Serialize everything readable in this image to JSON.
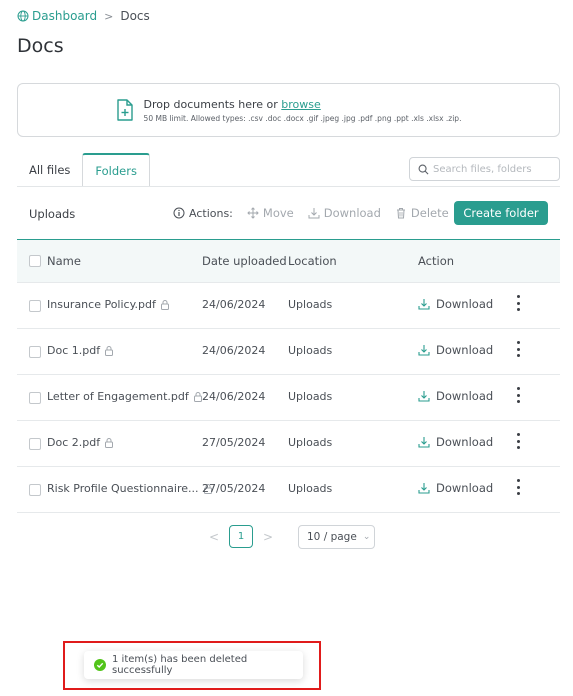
{
  "breadcrumb": {
    "home": "Dashboard",
    "separator": ">",
    "current": "Docs"
  },
  "page": {
    "title": "Docs"
  },
  "upload": {
    "prefix": "Drop documents here or ",
    "browse": "browse",
    "hint": "50 MB limit. Allowed types: .csv .doc .docx .gif .jpeg .jpg .pdf .png .ppt .xls .xlsx .zip."
  },
  "tabs": [
    {
      "label": "All files"
    },
    {
      "label": "Folders",
      "active": true
    }
  ],
  "search": {
    "placeholder": "Search files, folders",
    "value": ""
  },
  "toolbar": {
    "folder": "Uploads",
    "actions_label": "Actions:",
    "move": "Move",
    "download": "Download",
    "delete": "Delete",
    "create": "Create folder"
  },
  "table": {
    "headers": {
      "name": "Name",
      "date": "Date uploaded",
      "location": "Location",
      "action": "Action"
    },
    "rows": [
      {
        "name": "Insurance Policy.pdf",
        "date": "24/06/2024",
        "location": "Uploads",
        "action": "Download"
      },
      {
        "name": "Doc 1.pdf",
        "date": "24/06/2024",
        "location": "Uploads",
        "action": "Download"
      },
      {
        "name": "Letter of Engagement.pdf",
        "date": "24/06/2024",
        "location": "Uploads",
        "action": "Download"
      },
      {
        "name": "Doc 2.pdf",
        "date": "27/05/2024",
        "location": "Uploads",
        "action": "Download"
      },
      {
        "name": "Risk Profile Questionnaire...",
        "date": "27/05/2024",
        "location": "Uploads",
        "action": "Download"
      }
    ]
  },
  "pagination": {
    "prev": "<",
    "current": "1",
    "next": ">",
    "page_size": "10 / page"
  },
  "toast": {
    "message": "1 item(s) has been deleted successfully"
  },
  "colors": {
    "accent": "#2a9d8f",
    "highlight": "#e01b1b",
    "success": "#52c41a"
  }
}
